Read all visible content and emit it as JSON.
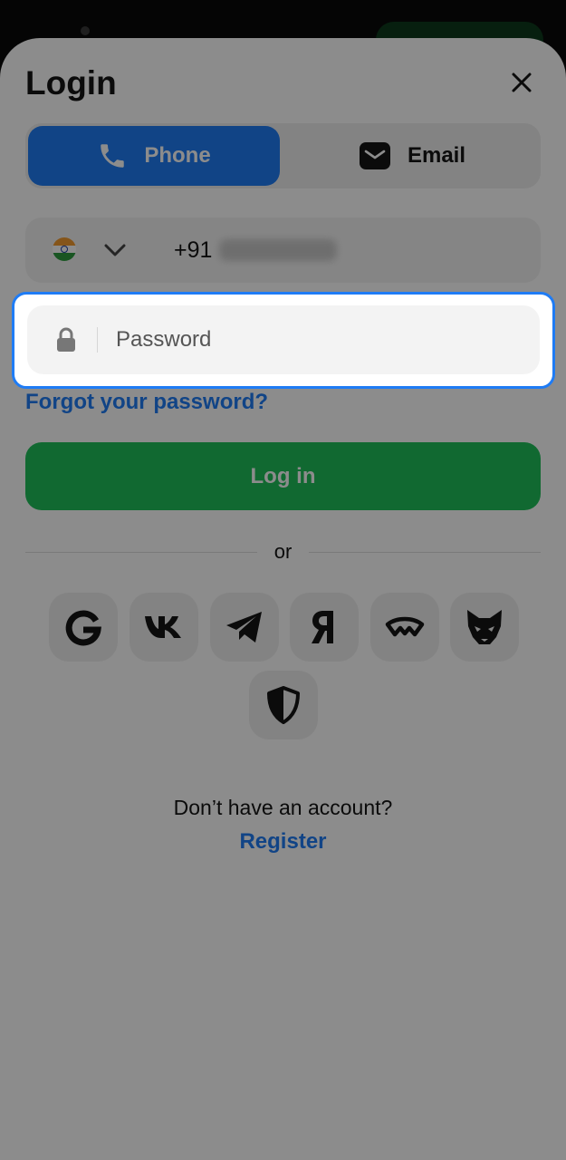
{
  "login": {
    "title": "Login",
    "tabs": [
      {
        "label": "Phone",
        "icon": "phone-icon",
        "active": true
      },
      {
        "label": "Email",
        "icon": "envelope-icon",
        "active": false
      }
    ],
    "phone": {
      "country_flag": "india-flag-icon",
      "dial_code": "+91"
    },
    "password": {
      "placeholder": "Password"
    },
    "forgot_label": "Forgot your password?",
    "login_label": "Log in",
    "divider_label": "or",
    "social_providers": [
      {
        "name": "google",
        "icon": "google-icon"
      },
      {
        "name": "vk",
        "icon": "vk-icon"
      },
      {
        "name": "telegram",
        "icon": "telegram-icon"
      },
      {
        "name": "yandex",
        "icon": "yandex-icon"
      },
      {
        "name": "walletconnect",
        "icon": "walletconnect-icon"
      },
      {
        "name": "metamask",
        "icon": "fox-icon"
      },
      {
        "name": "security",
        "icon": "shield-icon"
      }
    ],
    "no_account_text": "Don’t have an account?",
    "register_label": "Register"
  },
  "colors": {
    "accent_blue": "#1f7cf5",
    "login_green": "#1fbf5a",
    "field_bg": "#f3f3f3"
  }
}
